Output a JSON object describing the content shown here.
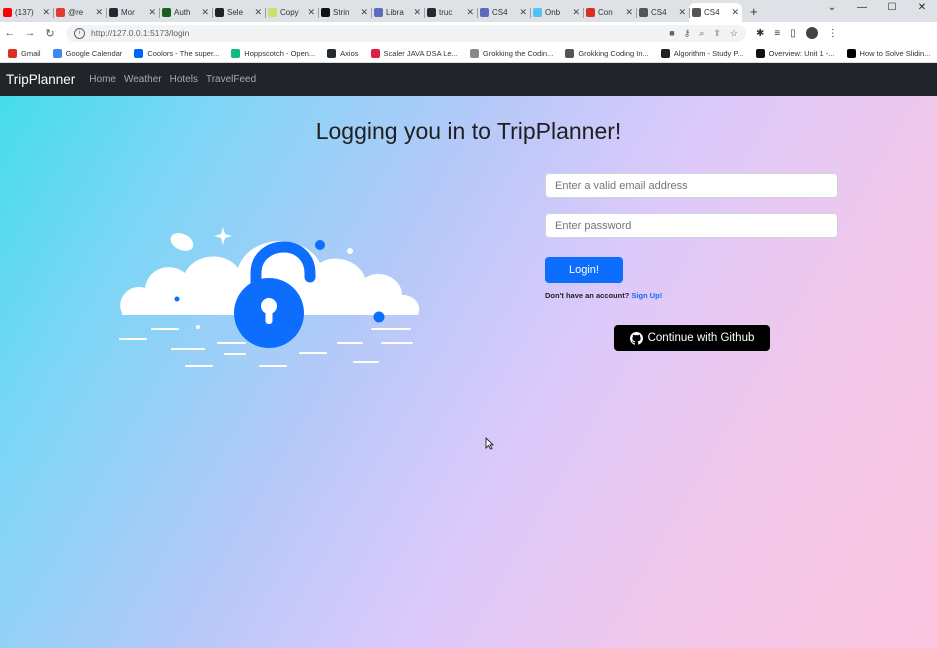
{
  "browser": {
    "tabs": [
      {
        "label": "(137)",
        "color": "#ff0000",
        "icon": "youtube-icon"
      },
      {
        "label": "@re",
        "color": "#e53935",
        "icon": "news-icon"
      },
      {
        "label": "Mor",
        "color": "#24292f",
        "icon": "github-icon"
      },
      {
        "label": "Auth",
        "color": "#1b5e20",
        "icon": "app-icon"
      },
      {
        "label": "Sele",
        "color": "#222222",
        "icon": "app-icon"
      },
      {
        "label": "Copy",
        "color": "#c6e36b",
        "icon": "app-icon"
      },
      {
        "label": "Strin",
        "color": "#111111",
        "icon": "app-icon"
      },
      {
        "label": "Libra",
        "color": "#5c6bc0",
        "icon": "app-icon"
      },
      {
        "label": "truc",
        "color": "#24292f",
        "icon": "github-icon"
      },
      {
        "label": "CS4",
        "color": "#5c6bc0",
        "icon": "app-icon"
      },
      {
        "label": "Onb",
        "color": "#4fc3f7",
        "icon": "app-icon"
      },
      {
        "label": "Con",
        "color": "#d93025",
        "icon": "gmail-icon"
      },
      {
        "label": "CS4",
        "color": "#555555",
        "icon": "globe-icon"
      },
      {
        "label": "CS4",
        "color": "#555555",
        "icon": "globe-icon",
        "active": true
      }
    ],
    "new_tab": "+",
    "address": "http://127.0.0.1:5173/login",
    "bookmarks": [
      {
        "label": "Gmail",
        "color": "#d93025"
      },
      {
        "label": "Google Calendar",
        "color": "#4285f4"
      },
      {
        "label": "Coolors - The super...",
        "color": "#0066ff"
      },
      {
        "label": "Hoppscotch - Open...",
        "color": "#10b981"
      },
      {
        "label": "Axios",
        "color": "#24292f"
      },
      {
        "label": "Scaler JAVA DSA Le...",
        "color": "#e11d48"
      },
      {
        "label": "Grokking the Codin...",
        "color": "#888888"
      },
      {
        "label": "Grokking Coding In...",
        "color": "#555555"
      },
      {
        "label": "Algorithm - Study P...",
        "color": "#222222"
      },
      {
        "label": "Overview: Unit 1 -...",
        "color": "#111111"
      },
      {
        "label": "How to Solve Slidin...",
        "color": "#000000"
      }
    ]
  },
  "app": {
    "brand": "TripPlanner",
    "nav": [
      "Home",
      "Weather",
      "Hotels",
      "TravelFeed"
    ],
    "heading": "Logging you in to TripPlanner!",
    "email_placeholder": "Enter a valid email address",
    "password_placeholder": "Enter password",
    "login_label": "Login!",
    "signup_prompt": "Don't have an account?",
    "signup_link": "Sign Up!",
    "github_label": "Continue with Github",
    "accent_color": "#0d6efd",
    "illustration_icon": "unlocked-padlock-cloud-icon"
  }
}
